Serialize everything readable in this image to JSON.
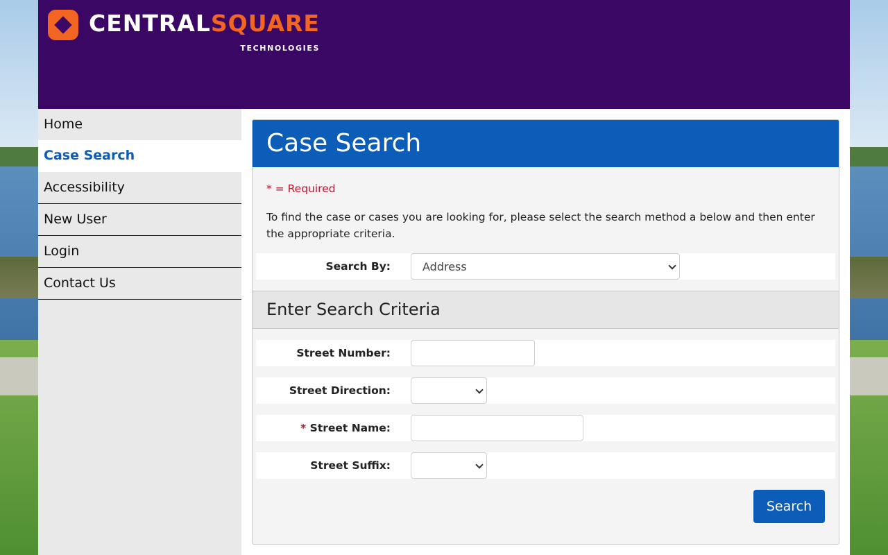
{
  "brand": {
    "name_part1": "CENTRAL",
    "name_part2": "SQUARE",
    "subtitle": "TECHNOLOGIES",
    "colors": {
      "header_bg": "#3b0764",
      "accent_orange": "#f26522",
      "primary_blue": "#0c5db8",
      "required_red": "#c8102e"
    }
  },
  "nav": {
    "items": [
      {
        "label": "Home",
        "active": false
      },
      {
        "label": "Case Search",
        "active": true
      },
      {
        "label": "Accessibility",
        "active": false
      },
      {
        "label": "New User",
        "active": false
      },
      {
        "label": "Login",
        "active": false
      },
      {
        "label": "Contact Us",
        "active": false
      }
    ]
  },
  "main": {
    "title": "Case Search",
    "required_note": "* = Required",
    "instructions": "To find the case or cases you are looking for, please select the search method a below and then enter the appropriate criteria.",
    "search_by": {
      "label": "Search By:",
      "value": "Address"
    },
    "criteria_title": "Enter Search Criteria",
    "fields": {
      "street_number": {
        "label": "Street Number:",
        "value": ""
      },
      "street_direction": {
        "label": "Street Direction:",
        "value": ""
      },
      "street_name": {
        "label": "Street Name:",
        "required_mark": "*",
        "value": ""
      },
      "street_suffix": {
        "label": "Street Suffix:",
        "value": ""
      }
    },
    "search_button": "Search"
  }
}
